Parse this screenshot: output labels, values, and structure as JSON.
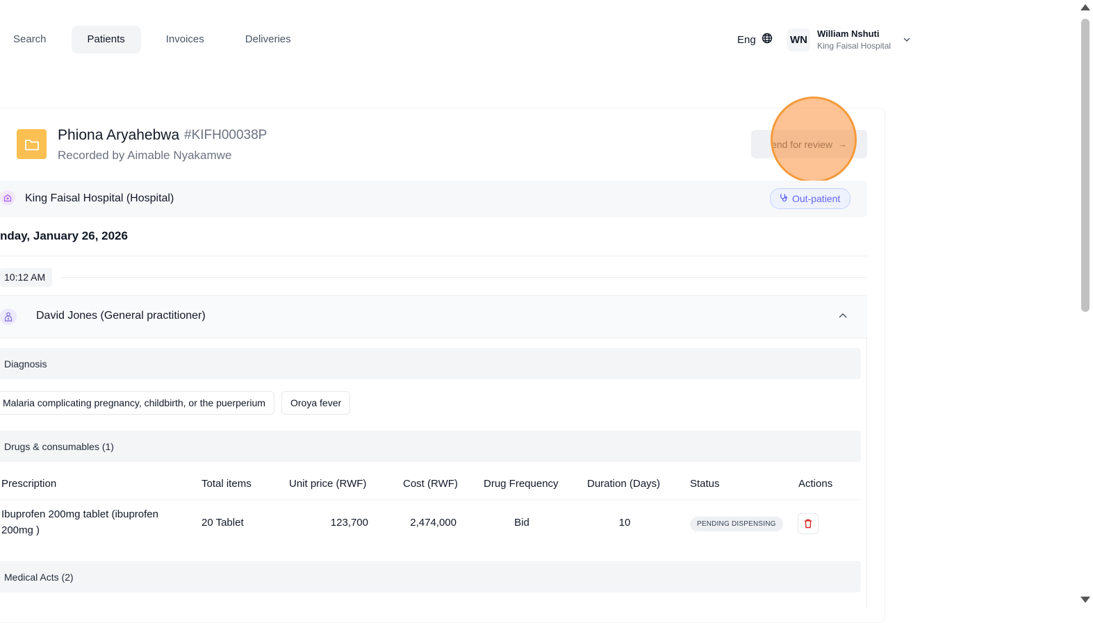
{
  "nav": {
    "items": [
      {
        "label": "Search",
        "active": false
      },
      {
        "label": "Patients",
        "active": true
      },
      {
        "label": "Invoices",
        "active": false
      },
      {
        "label": "Deliveries",
        "active": false
      }
    ]
  },
  "header": {
    "language": "Eng",
    "user": {
      "initials": "WN",
      "name": "William Nshuti",
      "organization": "King Faisal Hospital"
    }
  },
  "patient": {
    "name": "Phiona Aryahebwa",
    "id": "#KIFH00038P",
    "recorded_by": "Recorded by Aimable Nyakamwe",
    "action_button": "end for review",
    "action_arrow": "→"
  },
  "facility": {
    "name": "King Faisal Hospital (Hospital)",
    "visit_type": "Out-patient"
  },
  "visit": {
    "date": "nday, January 26, 2026",
    "time": "10:12 AM",
    "practitioner": "David Jones  (General practitioner)"
  },
  "diagnosis": {
    "title": "Diagnosis",
    "items": [
      "Malaria complicating pregnancy, childbirth, or the puerperium",
      "Oroya fever"
    ]
  },
  "drugs": {
    "title": "Drugs & consumables (1)",
    "columns": [
      "Prescription",
      "Total items",
      "Unit price (RWF)",
      "Cost (RWF)",
      "Drug Frequency",
      "Duration (Days)",
      "Status",
      "Actions"
    ],
    "rows": [
      {
        "prescription_line1": "Ibuprofen 200mg tablet (ibuprofen",
        "prescription_line2": "200mg )",
        "total_items": "20 Tablet",
        "unit_price": "123,700",
        "cost": "2,474,000",
        "frequency": "Bid",
        "duration": "10",
        "status": "PENDING DISPENSING"
      }
    ]
  },
  "medical_acts": {
    "title": "Medical Acts (2)"
  },
  "colors": {
    "folder": "#fbbf52",
    "click_indicator": "#f59a3b",
    "outpatient": "#6366f1",
    "delete": "#dc2626"
  },
  "icons": [
    "globe-icon",
    "chevron-down-icon",
    "folder-icon",
    "arrow-right-icon",
    "hospital-icon",
    "stethoscope-icon",
    "doctor-icon",
    "chevron-up-icon",
    "trash-icon"
  ]
}
